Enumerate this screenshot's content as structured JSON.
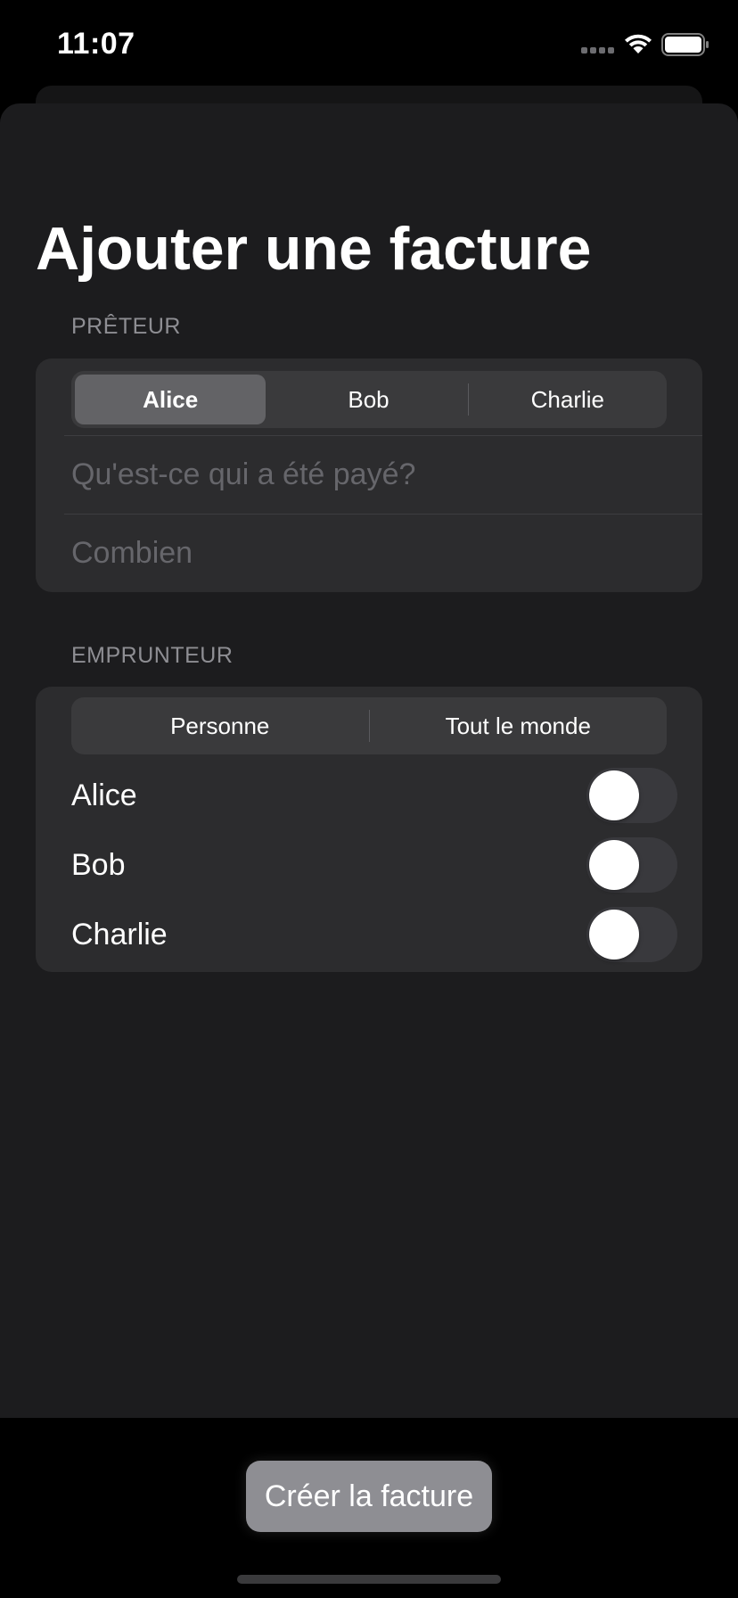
{
  "status_bar": {
    "time": "11:07"
  },
  "page": {
    "title": "Ajouter une facture"
  },
  "lender_section": {
    "header": "PRÊTEUR",
    "segments": [
      {
        "label": "Alice",
        "selected": true
      },
      {
        "label": "Bob",
        "selected": false
      },
      {
        "label": "Charlie",
        "selected": false
      }
    ],
    "description_field": {
      "value": "",
      "placeholder": "Qu'est-ce qui a été payé?"
    },
    "amount_field": {
      "value": "",
      "placeholder": "Combien"
    }
  },
  "borrower_section": {
    "header": "EMPRUNTEUR",
    "segments": [
      {
        "label": "Personne"
      },
      {
        "label": "Tout le monde"
      }
    ],
    "toggles": [
      {
        "label": "Alice",
        "on": false
      },
      {
        "label": "Bob",
        "on": false
      },
      {
        "label": "Charlie",
        "on": false
      }
    ]
  },
  "actions": {
    "create_label": "Créer la facture"
  },
  "colors": {
    "background": "#000000",
    "sheet": "#1c1c1e",
    "group": "#2c2c2e",
    "segment_selected": "#636366",
    "button": "#8e8e93"
  }
}
